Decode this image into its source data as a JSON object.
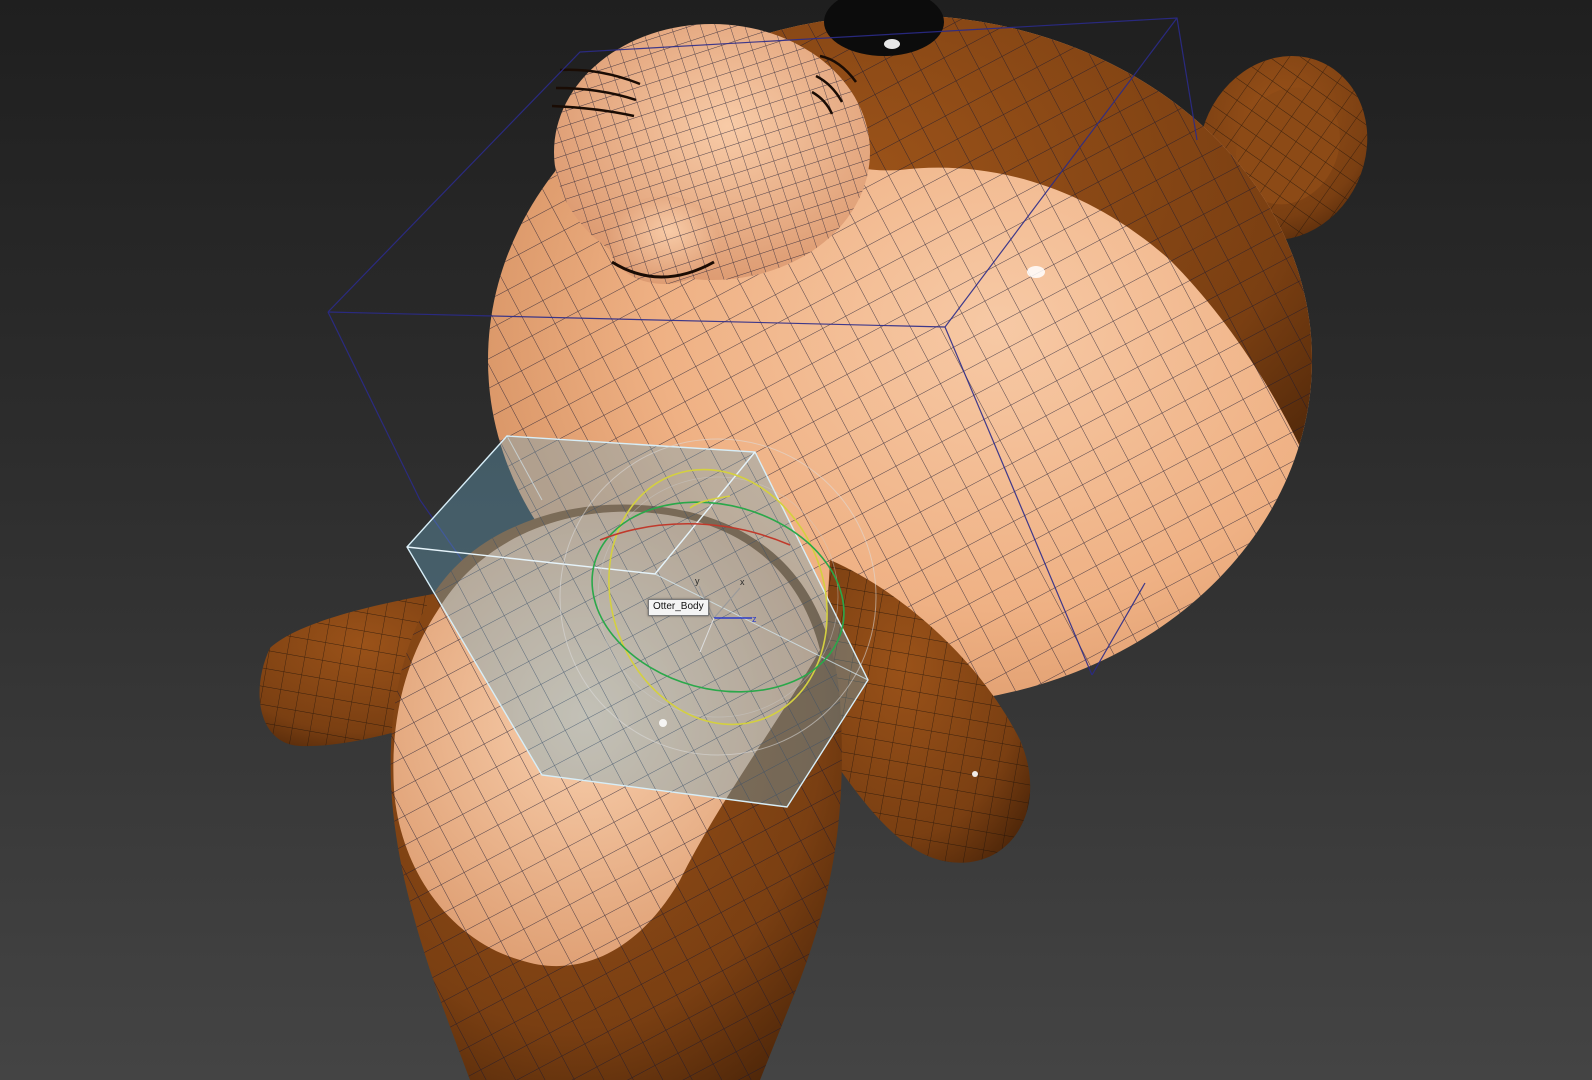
{
  "viewport": {
    "selected_object_label": "Otter_Body",
    "axis_labels": {
      "x": "x",
      "y": "y",
      "z": "z"
    }
  },
  "colors": {
    "background_top": "#1f1f1f",
    "background_bottom": "#444444",
    "fur_dark": "#7a3f12",
    "fur_light": "#f3b88e",
    "wireframe": "#1a1830",
    "bounding_box_outline": "#2b2b8a",
    "selection_box_fill": "#6aa7c6",
    "gizmo_x": "#c0392b",
    "gizmo_y": "#d4d040",
    "gizmo_z": "#2aa84a"
  },
  "icons": {
    "transform_gizmo": "rotate-gizmo-icon",
    "pivot_axes": "pivot-tripod-icon"
  }
}
